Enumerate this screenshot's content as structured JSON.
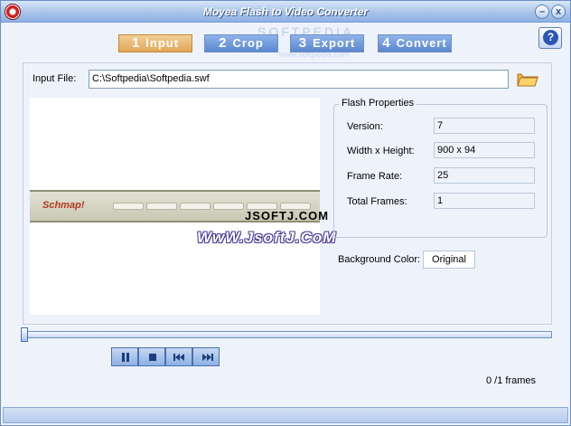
{
  "window": {
    "title": "Moyea Flash to Video Converter",
    "minimize_label": "–",
    "close_label": "x",
    "watermark_top": "SOFTPEDIA",
    "watermark_sub": "www.softpedia.com"
  },
  "steps": [
    {
      "num": "1",
      "label": "Input",
      "active": true
    },
    {
      "num": "2",
      "label": "Crop",
      "active": false
    },
    {
      "num": "3",
      "label": "Export",
      "active": false
    },
    {
      "num": "4",
      "label": "Convert",
      "active": false
    }
  ],
  "help": {
    "label": "?"
  },
  "input_file": {
    "label": "Input File:",
    "value": "C:\\Softpedia\\Softpedia.swf"
  },
  "preview": {
    "flash_brand": "Schmap!",
    "watermark_1": "JSOFTJ.COM",
    "watermark_2": "WwW.JsoftJ.CoM"
  },
  "flash_properties": {
    "title": "Flash Properties",
    "rows": [
      {
        "label": "Version:",
        "value": "7"
      },
      {
        "label": "Width x Height:",
        "value": "900 x 94"
      },
      {
        "label": "Frame Rate:",
        "value": "25"
      },
      {
        "label": "Total Frames:",
        "value": "1"
      }
    ]
  },
  "background_color": {
    "label": "Background Color:",
    "value": "Original"
  },
  "player": {
    "seek_fraction": 0.0,
    "frames_text": "0 /1 frames"
  },
  "colors": {
    "accent": "#5a86cf",
    "active_step": "#e0a657"
  }
}
